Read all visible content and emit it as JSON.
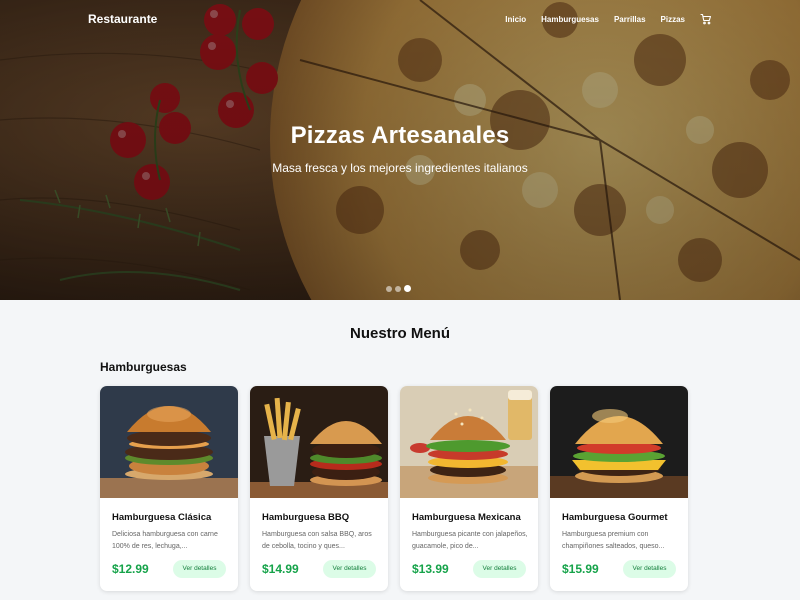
{
  "navbar": {
    "brand": "Restaurante",
    "links": [
      "Inicio",
      "Hamburguesas",
      "Parrillas",
      "Pizzas"
    ],
    "cart_icon": "cart-icon"
  },
  "hero": {
    "title": "Pizzas Artesanales",
    "subtitle": "Masa fresca y los mejores ingredientes italianos",
    "slides_total": 3,
    "active_slide": 3
  },
  "menu": {
    "title": "Nuestro Menú",
    "section_title": "Hamburguesas",
    "items": [
      {
        "name": "Hamburguesa Clásica",
        "description": "Deliciosa hamburguesa con carne 100% de res, lechuga,...",
        "price": "$12.99",
        "button": "Ver detalles"
      },
      {
        "name": "Hamburguesa BBQ",
        "description": "Hamburguesa con salsa BBQ, aros de cebolla, tocino y ques...",
        "price": "$14.99",
        "button": "Ver detalles"
      },
      {
        "name": "Hamburguesa Mexicana",
        "description": "Hamburguesa picante con jalapeños, guacamole, pico de...",
        "price": "$13.99",
        "button": "Ver detalles"
      },
      {
        "name": "Hamburguesa Gourmet",
        "description": "Hamburguesa premium con champiñones salteados, queso...",
        "price": "$15.99",
        "button": "Ver detalles"
      }
    ]
  },
  "colors": {
    "accent_green": "#16a34a",
    "button_bg": "#dcfce7",
    "page_bg": "#f4f6f8"
  }
}
